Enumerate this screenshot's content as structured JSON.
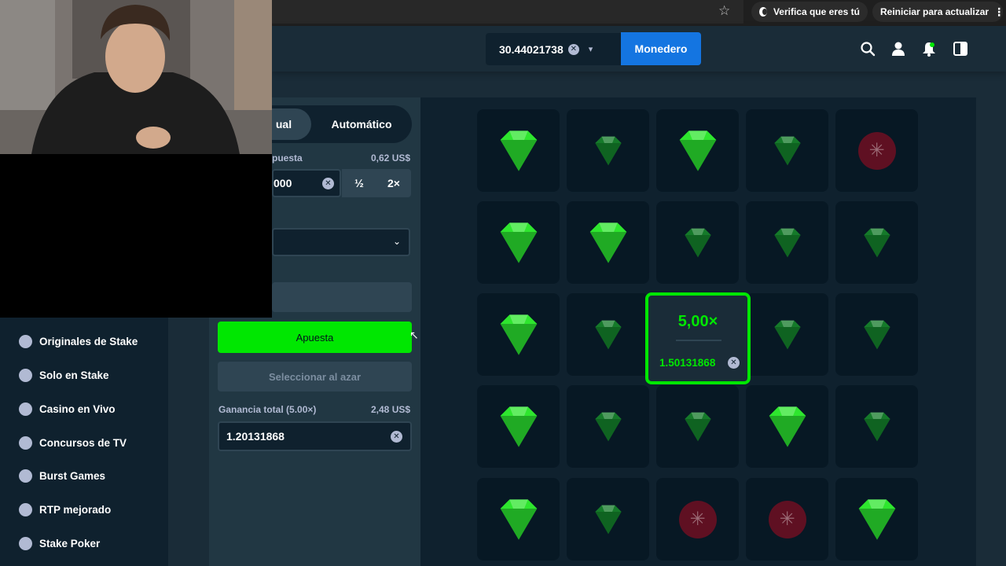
{
  "browser": {
    "verify_label": "Verifica que eres tú",
    "restart_label": "Reiniciar para actualizar"
  },
  "header": {
    "balance": "30.44021738",
    "wallet_label": "Monedero",
    "icons": [
      "search-icon",
      "user-icon",
      "notification-icon",
      "sidebar-toggle-icon"
    ]
  },
  "sidebar": {
    "items": [
      {
        "label": "Originales de Stake",
        "icon": "fire-icon"
      },
      {
        "label": "Solo en Stake",
        "icon": "stake-icon"
      },
      {
        "label": "Casino en Vivo",
        "icon": "cards-icon"
      },
      {
        "label": "Concursos de TV",
        "icon": "mic-icon"
      },
      {
        "label": "Burst Games",
        "icon": "crown-icon"
      },
      {
        "label": "RTP mejorado",
        "icon": "battery-icon"
      },
      {
        "label": "Stake Poker",
        "icon": "poker-chip-icon"
      }
    ]
  },
  "controls": {
    "mode_manual": "ual",
    "mode_auto": "Automático",
    "bet_label": "puesta",
    "bet_usd": "0,62 US$",
    "bet_value": "000",
    "half_label": "½",
    "double_label": "2×",
    "bet_button": "Apuesta",
    "random_button": "Seleccionar al azar",
    "profit_label": "Ganancia total (5.00×)",
    "profit_usd": "2,48 US$",
    "profit_value": "1.20131868"
  },
  "board": {
    "rows": [
      [
        "gem-bright",
        "gem-dim",
        "gem-bright",
        "gem-dim",
        "mine"
      ],
      [
        "gem-bright",
        "gem-bright",
        "gem-dim",
        "gem-dim",
        "gem-dim"
      ],
      [
        "gem-bright",
        "gem-dim",
        "win",
        "gem-dim",
        "gem-dim"
      ],
      [
        "gem-bright",
        "gem-dim",
        "gem-dim",
        "gem-bright",
        "gem-dim"
      ],
      [
        "gem-bright",
        "gem-dim",
        "mine",
        "mine",
        "gem-bright"
      ]
    ],
    "win_multiplier": "5,00×",
    "win_amount": "1.50131868"
  },
  "colors": {
    "accent_green": "#00e701",
    "wallet_blue": "#1475e1",
    "gem_bright": "#2ee62e",
    "gem_dim": "#157a2a",
    "mine": "#5f1022"
  }
}
